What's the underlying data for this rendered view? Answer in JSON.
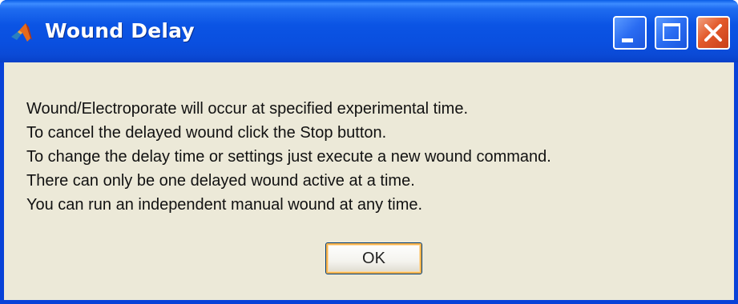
{
  "window": {
    "title": "Wound Delay",
    "icon": "matlab-logo-icon",
    "controls": {
      "minimize_icon": "minimize-icon",
      "maximize_icon": "maximize-icon",
      "close_icon": "close-icon"
    }
  },
  "message": {
    "lines": [
      "Wound/Electroporate will occur at specified experimental time.",
      "To cancel the delayed wound click the Stop button.",
      "To change the delay time or settings just execute a new wound command.",
      "There can only be one delayed wound active at a time.",
      "You can run an independent manual wound at any time."
    ]
  },
  "buttons": {
    "ok_label": "OK"
  },
  "colors": {
    "titlebar": "#0a4fdf",
    "client_background": "#ece9d8",
    "close_button": "#e35a2a"
  }
}
